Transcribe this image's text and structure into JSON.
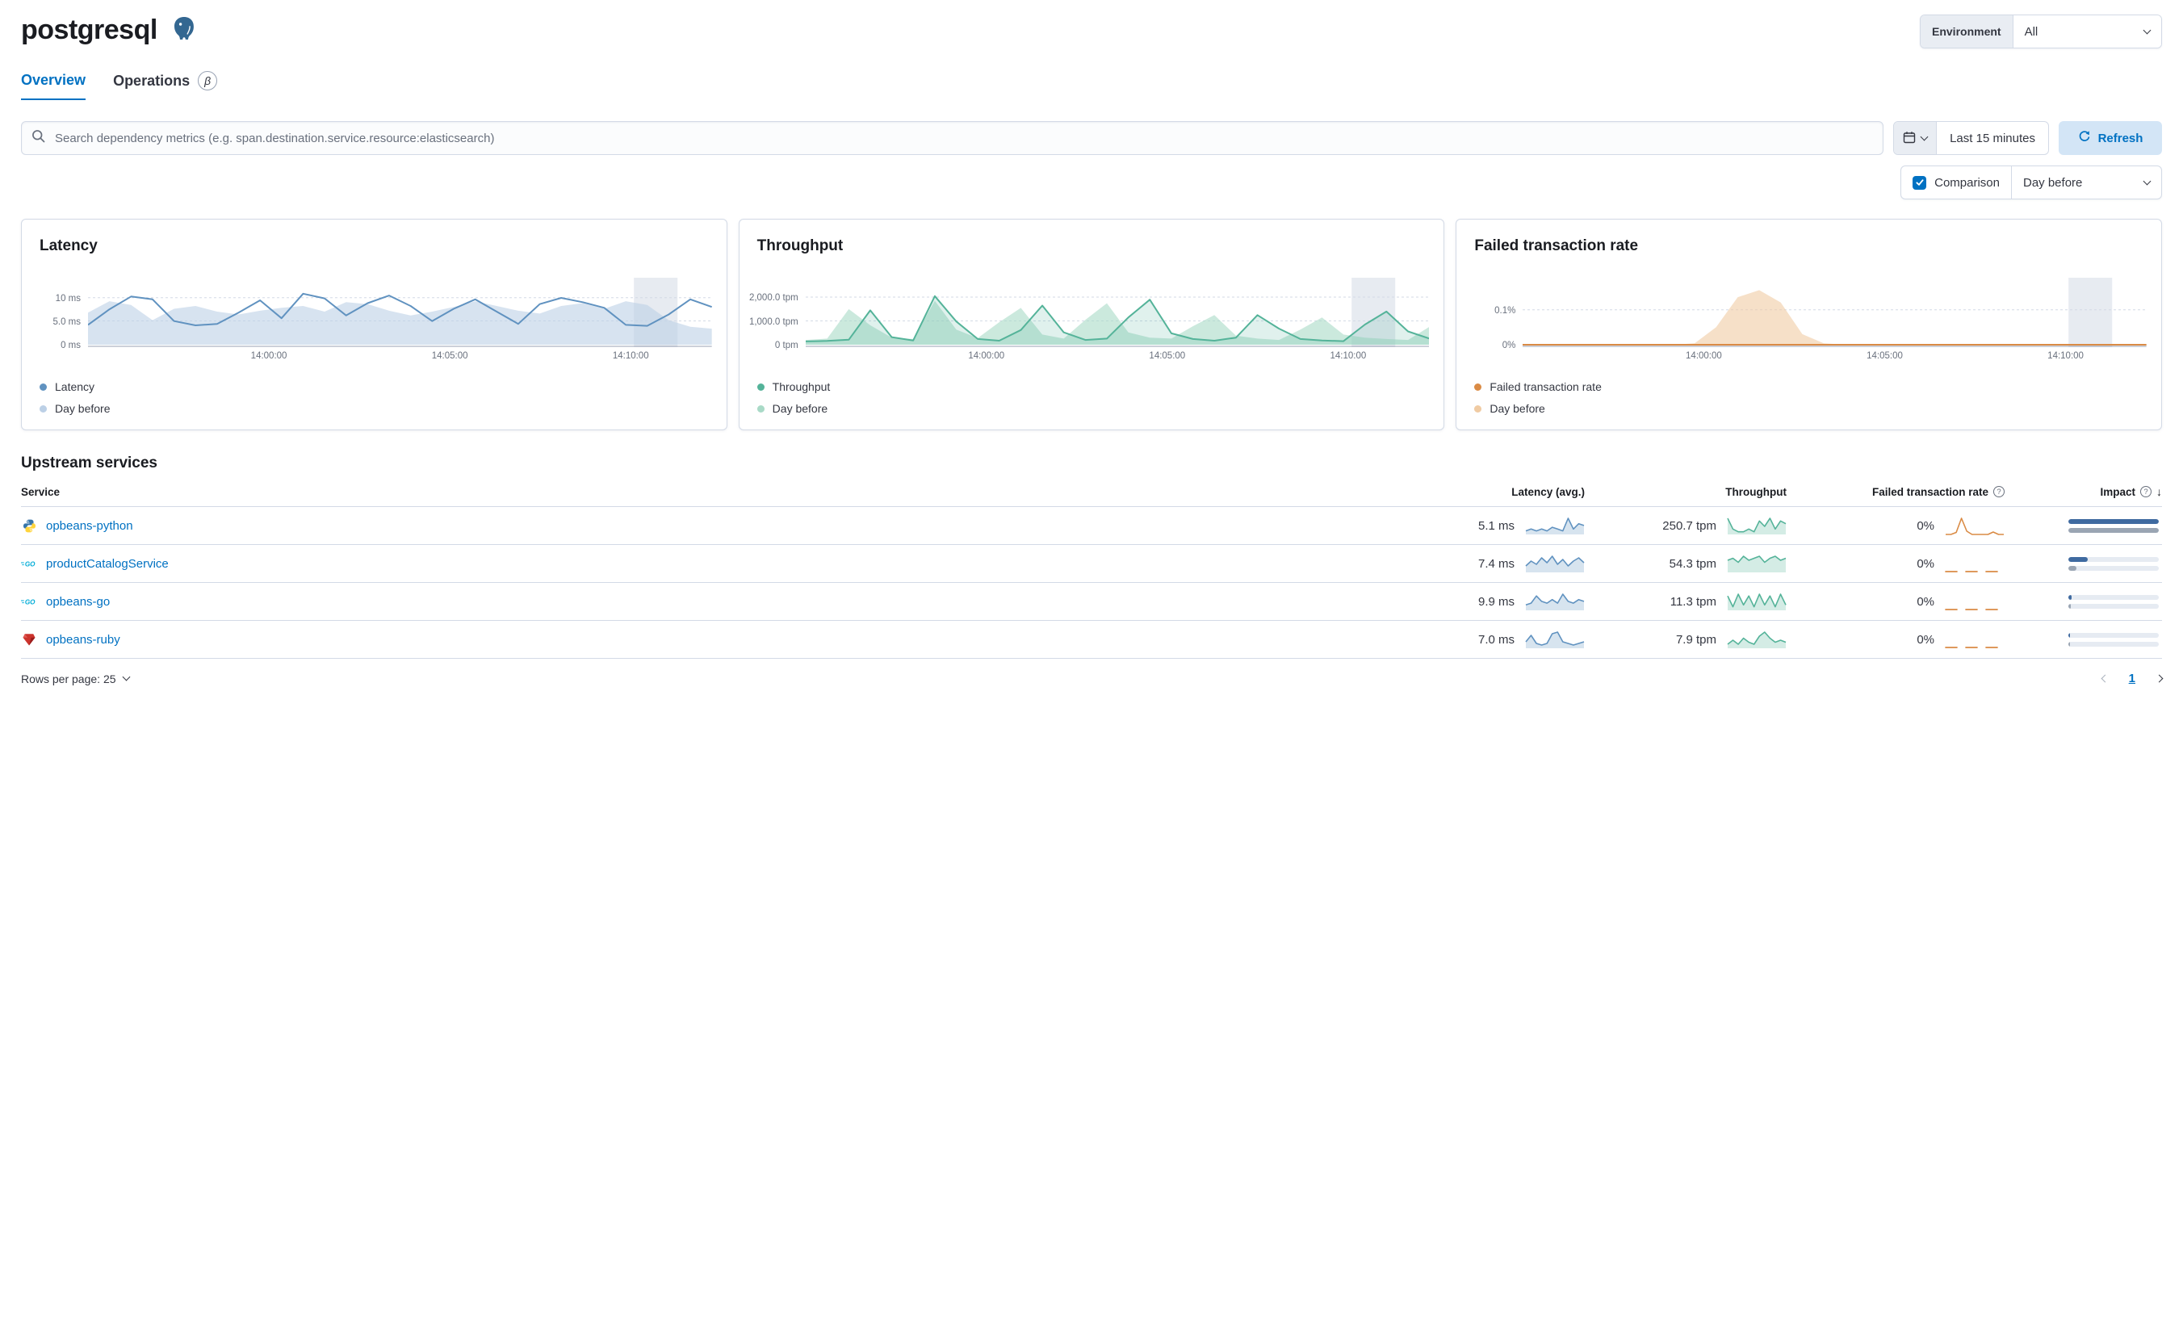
{
  "header": {
    "title": "postgresql",
    "env_label": "Environment",
    "env_value": "All"
  },
  "tabs": [
    {
      "label": "Overview",
      "active": true
    },
    {
      "label": "Operations",
      "badge": "β"
    }
  ],
  "toolbar": {
    "search_placeholder": "Search dependency metrics (e.g. span.destination.service.resource:elasticsearch)",
    "time_range": "Last 15 minutes",
    "refresh_label": "Refresh",
    "comparison_label": "Comparison",
    "comparison_value": "Day before"
  },
  "colors": {
    "latency": "#6092C0",
    "latency_compare": "#BCD0E6",
    "throughput": "#54B399",
    "throughput_compare": "#A9DAC7",
    "failed": "#DA8B45",
    "failed_compare": "#F0CBA3",
    "link": "#0071C2",
    "impact_current": "#3F6AA0",
    "impact_previous": "#9AA5B3"
  },
  "charts": [
    {
      "key": "latency",
      "title": "Latency",
      "type": "line",
      "max": 12.3,
      "color": "#6092C0",
      "compare_color": "#BCD0E6",
      "fill_current": false,
      "y_ticks": [
        {
          "label": "10 ms",
          "frac": 0.81
        },
        {
          "label": "5.0 ms",
          "frac": 0.41
        },
        {
          "label": "0 ms",
          "frac": 0
        }
      ],
      "x_ticks": [
        {
          "label": "14:00:00",
          "frac": 0.29
        },
        {
          "label": "14:05:00",
          "frac": 0.58
        },
        {
          "label": "14:10:00",
          "frac": 0.87
        }
      ],
      "band": [
        0.875,
        0.945
      ],
      "current": [
        4.2,
        7.5,
        10.2,
        9.6,
        5.0,
        4.1,
        4.4,
        6.8,
        9.4,
        5.6,
        10.8,
        9.8,
        6.2,
        8.8,
        10.4,
        8.2,
        5.0,
        7.6,
        9.6,
        7.0,
        4.4,
        8.6,
        9.9,
        9.0,
        7.8,
        4.2,
        4.0,
        6.4,
        9.6,
        8.0
      ],
      "compare": [
        6.8,
        9.2,
        8.4,
        5.2,
        7.6,
        8.2,
        7.0,
        6.4,
        7.2,
        7.8,
        8.2,
        7.0,
        9.0,
        8.6,
        7.2,
        6.2,
        7.0,
        8.0,
        9.2,
        8.2,
        7.2,
        6.6,
        8.2,
        8.8,
        7.6,
        9.2,
        8.4,
        5.2,
        3.8,
        3.4
      ],
      "legend": [
        {
          "label": "Latency",
          "color": "#6092C0"
        },
        {
          "label": "Day before",
          "color": "#BCD0E6"
        }
      ]
    },
    {
      "key": "throughput",
      "title": "Throughput",
      "type": "line",
      "max": 2450,
      "color": "#54B399",
      "compare_color": "#A9DAC7",
      "fill_current": true,
      "y_ticks": [
        {
          "label": "2,000.0 tpm",
          "frac": 0.82
        },
        {
          "label": "1,000.0 tpm",
          "frac": 0.41
        },
        {
          "label": "0 tpm",
          "frac": 0
        }
      ],
      "x_ticks": [
        {
          "label": "14:00:00",
          "frac": 0.29
        },
        {
          "label": "14:05:00",
          "frac": 0.58
        },
        {
          "label": "14:10:00",
          "frac": 0.87
        }
      ],
      "band": [
        0.875,
        0.945
      ],
      "current": [
        140,
        160,
        210,
        1450,
        320,
        180,
        2050,
        980,
        240,
        170,
        620,
        1650,
        520,
        200,
        260,
        1150,
        1900,
        480,
        240,
        170,
        300,
        1250,
        680,
        240,
        180,
        150,
        850,
        1400,
        560,
        260
      ],
      "compare": [
        200,
        260,
        1500,
        820,
        300,
        240,
        1850,
        640,
        280,
        950,
        1550,
        430,
        260,
        1050,
        1750,
        520,
        300,
        260,
        780,
        1250,
        380,
        260,
        200,
        640,
        1150,
        430,
        300,
        240,
        200,
        760
      ],
      "legend": [
        {
          "label": "Throughput",
          "color": "#54B399"
        },
        {
          "label": "Day before",
          "color": "#A9DAC7"
        }
      ]
    },
    {
      "key": "failed-rate",
      "title": "Failed transaction rate",
      "type": "line",
      "max": 0.165,
      "color": "#DA8B45",
      "compare_color": "#F0CBA3",
      "fill_current": false,
      "y_ticks": [
        {
          "label": "0.1%",
          "frac": 0.6
        },
        {
          "label": "0%",
          "frac": 0
        }
      ],
      "x_ticks": [
        {
          "label": "14:00:00",
          "frac": 0.29
        },
        {
          "label": "14:05:00",
          "frac": 0.58
        },
        {
          "label": "14:10:00",
          "frac": 0.87
        }
      ],
      "band": [
        0.875,
        0.945
      ],
      "current": [
        0,
        0,
        0,
        0,
        0,
        0,
        0,
        0,
        0,
        0,
        0,
        0,
        0,
        0,
        0,
        0,
        0,
        0,
        0,
        0,
        0,
        0,
        0,
        0,
        0,
        0,
        0,
        0,
        0,
        0
      ],
      "compare": [
        0,
        0,
        0,
        0,
        0,
        0,
        0,
        0,
        0.004,
        0.05,
        0.135,
        0.155,
        0.12,
        0.03,
        0.004,
        0,
        0,
        0,
        0,
        0,
        0,
        0,
        0,
        0,
        0,
        0,
        0,
        0,
        0,
        0
      ],
      "legend": [
        {
          "label": "Failed transaction rate",
          "color": "#DA8B45"
        },
        {
          "label": "Day before",
          "color": "#F0CBA3"
        }
      ]
    }
  ],
  "upstream": {
    "heading": "Upstream services",
    "columns": {
      "service": "Service",
      "latency": "Latency (avg.)",
      "throughput": "Throughput",
      "failed": "Failed transaction rate",
      "impact": "Impact"
    },
    "rows": [
      {
        "name": "opbeans-python",
        "icon": "python",
        "latency": "5.1 ms",
        "throughput": "250.7 tpm",
        "failed": "0%",
        "impact": {
          "current": 100,
          "previous": 100
        },
        "spark_latency": [
          2,
          3,
          2,
          3,
          2,
          4,
          3,
          2,
          9,
          3,
          6,
          5
        ],
        "spark_throughput": [
          6,
          2,
          1,
          1,
          2,
          1,
          5,
          3,
          6,
          2,
          5,
          4
        ],
        "spark_failed": [
          0,
          0,
          0.5,
          4,
          0.8,
          0,
          0,
          0,
          0,
          0.6,
          0,
          0
        ]
      },
      {
        "name": "productCatalogService",
        "icon": "go",
        "latency": "7.4 ms",
        "throughput": "54.3 tpm",
        "failed": "0%",
        "impact": {
          "current": 21,
          "previous": 9
        },
        "spark_latency": [
          4,
          7,
          5,
          9,
          6,
          10,
          5,
          8,
          4,
          7,
          9,
          6
        ],
        "spark_throughput": [
          6,
          7,
          5,
          8,
          6,
          7,
          8,
          5,
          7,
          8,
          6,
          7
        ],
        "spark_failed": [
          0,
          0,
          0,
          0,
          0,
          0,
          0,
          0,
          0,
          0,
          0,
          0
        ]
      },
      {
        "name": "opbeans-go",
        "icon": "go",
        "latency": "9.9 ms",
        "throughput": "11.3 tpm",
        "failed": "0%",
        "impact": {
          "current": 4,
          "previous": 3
        },
        "spark_latency": [
          3,
          4,
          8,
          5,
          4,
          6,
          4,
          9,
          5,
          4,
          6,
          5
        ],
        "spark_throughput": [
          8,
          2,
          9,
          3,
          8,
          2,
          9,
          3,
          8,
          2,
          9,
          3
        ],
        "spark_failed": [
          0,
          0,
          0,
          0,
          0,
          0,
          0,
          0,
          0,
          0,
          0,
          0
        ]
      },
      {
        "name": "opbeans-ruby",
        "icon": "ruby",
        "latency": "7.0 ms",
        "throughput": "7.9 tpm",
        "failed": "0%",
        "impact": {
          "current": 2,
          "previous": 2
        },
        "spark_latency": [
          4,
          8,
          3,
          2,
          3,
          9,
          10,
          4,
          3,
          2,
          3,
          4
        ],
        "spark_throughput": [
          2,
          4,
          2,
          5,
          3,
          2,
          6,
          8,
          5,
          3,
          4,
          3
        ],
        "spark_failed": [
          0,
          0,
          0,
          0,
          0,
          0,
          0,
          0,
          0,
          0,
          0,
          0
        ]
      }
    ],
    "footer": {
      "rows_per_page": "Rows per page: 25",
      "page": "1"
    }
  }
}
